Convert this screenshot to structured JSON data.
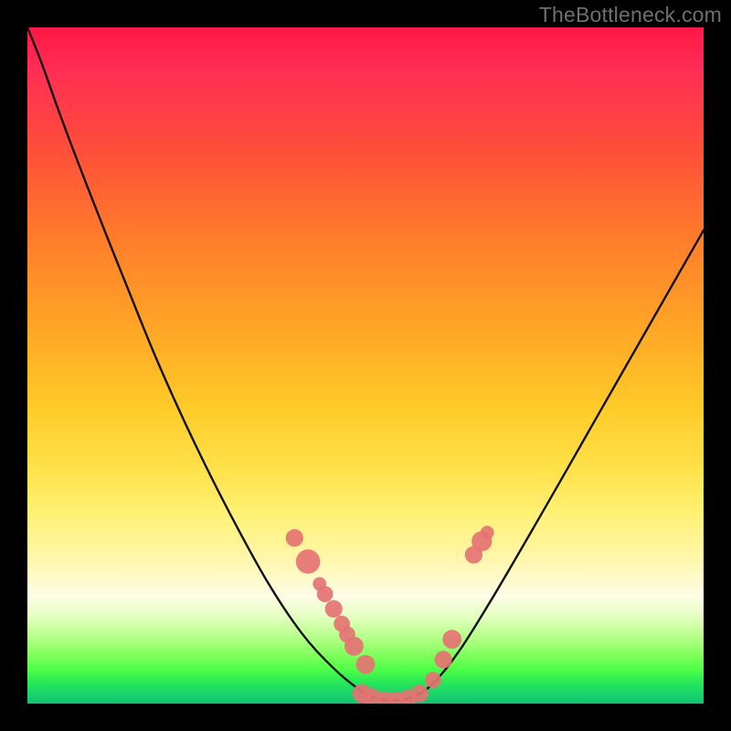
{
  "watermark": "TheBottleneck.com",
  "colors": {
    "frame": "#000000",
    "curve": "#111111",
    "marker_fill": "#e57373",
    "marker_stroke": "#c85a5a"
  },
  "chart_data": {
    "type": "line",
    "title": "",
    "xlabel": "",
    "ylabel": "",
    "xlim": [
      0,
      1
    ],
    "ylim": [
      0,
      1
    ],
    "series": [
      {
        "name": "curve",
        "x": [
          0.0,
          0.02,
          0.045,
          0.075,
          0.11,
          0.15,
          0.195,
          0.245,
          0.3,
          0.355,
          0.405,
          0.45,
          0.485,
          0.51,
          0.54,
          0.57,
          0.6,
          0.64,
          0.69,
          0.76,
          0.84,
          0.92,
          1.0
        ],
        "y": [
          1.0,
          0.95,
          0.88,
          0.8,
          0.71,
          0.61,
          0.5,
          0.39,
          0.28,
          0.18,
          0.105,
          0.055,
          0.025,
          0.01,
          0.005,
          0.01,
          0.03,
          0.08,
          0.16,
          0.28,
          0.42,
          0.56,
          0.7
        ]
      }
    ],
    "markers": [
      {
        "x": 0.395,
        "y": 0.245,
        "r": 0.013
      },
      {
        "x": 0.415,
        "y": 0.21,
        "r": 0.018
      },
      {
        "x": 0.432,
        "y": 0.177,
        "r": 0.01
      },
      {
        "x": 0.44,
        "y": 0.162,
        "r": 0.012
      },
      {
        "x": 0.453,
        "y": 0.14,
        "r": 0.013
      },
      {
        "x": 0.465,
        "y": 0.118,
        "r": 0.012
      },
      {
        "x": 0.473,
        "y": 0.102,
        "r": 0.012
      },
      {
        "x": 0.483,
        "y": 0.085,
        "r": 0.014
      },
      {
        "x": 0.5,
        "y": 0.058,
        "r": 0.014
      },
      {
        "x": 0.495,
        "y": 0.015,
        "r": 0.014
      },
      {
        "x": 0.51,
        "y": 0.008,
        "r": 0.014
      },
      {
        "x": 0.528,
        "y": 0.005,
        "r": 0.013
      },
      {
        "x": 0.545,
        "y": 0.005,
        "r": 0.013
      },
      {
        "x": 0.563,
        "y": 0.008,
        "r": 0.013
      },
      {
        "x": 0.58,
        "y": 0.015,
        "r": 0.013
      },
      {
        "x": 0.6,
        "y": 0.035,
        "r": 0.012
      },
      {
        "x": 0.615,
        "y": 0.065,
        "r": 0.013
      },
      {
        "x": 0.628,
        "y": 0.095,
        "r": 0.014
      },
      {
        "x": 0.66,
        "y": 0.22,
        "r": 0.013
      },
      {
        "x": 0.672,
        "y": 0.24,
        "r": 0.015
      },
      {
        "x": 0.68,
        "y": 0.253,
        "r": 0.01
      }
    ]
  }
}
